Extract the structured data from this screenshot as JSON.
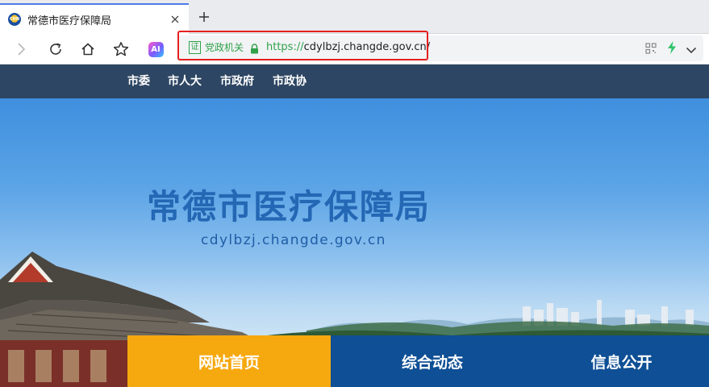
{
  "browser": {
    "tab": {
      "title": "常德市医疗保障局",
      "favicon": "changde-emblem-icon",
      "close_icon": "close-icon"
    },
    "new_tab_icon": "plus-icon",
    "toolbar": {
      "forward_icon": "forward-arrow-icon",
      "reload_icon": "reload-icon",
      "home_icon": "home-icon",
      "bookmark_icon": "star-icon",
      "ai_label": "AI"
    },
    "address_bar": {
      "cert_badge": "证",
      "org_label": "党政机关",
      "url_scheme": "https://",
      "url_rest": "cdylbzj.changde.gov.cn/",
      "secure_color": "#2fa24a",
      "highlight_color": "#e5201f"
    }
  },
  "site_nav": {
    "items": [
      "市委",
      "市人大",
      "市政府",
      "市政协"
    ],
    "background": "#2d4663"
  },
  "hero": {
    "title": "常德市医疗保障局",
    "domain": "cdylbzj.changde.gov.cn"
  },
  "main_menu": {
    "items": [
      {
        "label": "网站首页",
        "color": "#f6a80f"
      },
      {
        "label": "综合动态",
        "color": "#0e4f95"
      },
      {
        "label": "信息公开",
        "color": "#0e4f95"
      }
    ]
  }
}
